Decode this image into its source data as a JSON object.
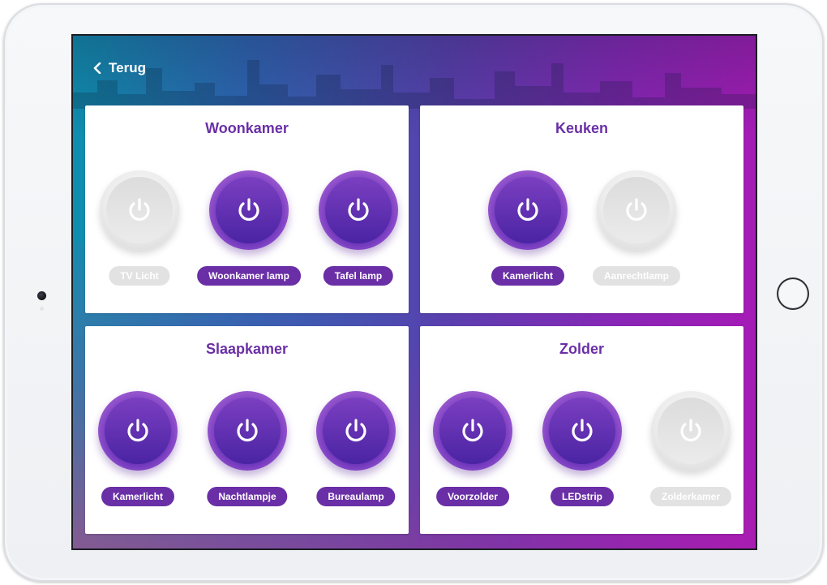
{
  "nav": {
    "back_label": "Terug"
  },
  "colors": {
    "accent": "#6a2fa6",
    "off": "#e2e2e2"
  },
  "rooms": [
    {
      "title": "Woonkamer",
      "lamps": [
        {
          "label": "TV Licht",
          "on": false
        },
        {
          "label": "Woonkamer lamp",
          "on": true
        },
        {
          "label": "Tafel lamp",
          "on": true
        }
      ]
    },
    {
      "title": "Keuken",
      "lamps": [
        {
          "label": "Kamerlicht",
          "on": true
        },
        {
          "label": "Aanrechtlamp",
          "on": false
        }
      ]
    },
    {
      "title": "Slaapkamer",
      "lamps": [
        {
          "label": "Kamerlicht",
          "on": true
        },
        {
          "label": "Nachtlampje",
          "on": true
        },
        {
          "label": "Bureaulamp",
          "on": true
        }
      ]
    },
    {
      "title": "Zolder",
      "lamps": [
        {
          "label": "Voorzolder",
          "on": true
        },
        {
          "label": "LEDstrip",
          "on": true
        },
        {
          "label": "Zolderkamer",
          "on": false
        }
      ]
    }
  ]
}
